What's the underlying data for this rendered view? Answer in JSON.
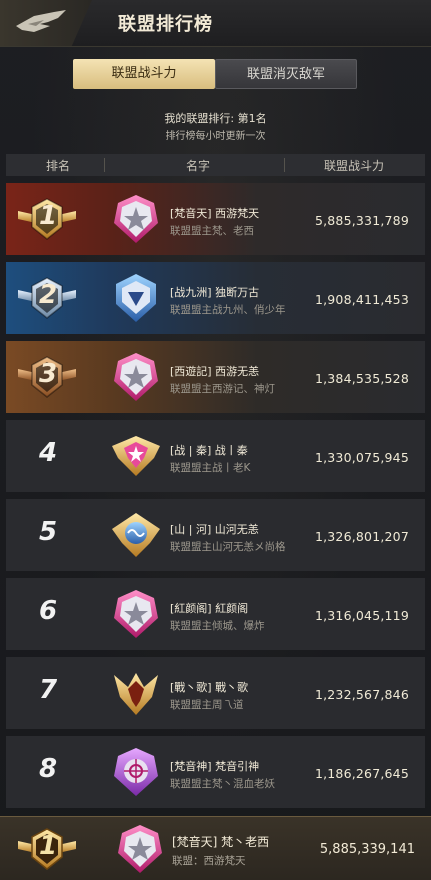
{
  "header": {
    "title": "联盟排行榜"
  },
  "tabs": [
    {
      "label": "联盟战斗力",
      "active": true
    },
    {
      "label": "联盟消灭敌军",
      "active": false
    }
  ],
  "my_rank_text": "我的联盟排行: 第1名",
  "refresh_note": "排行榜每小时更新一次",
  "columns": {
    "rank": "排名",
    "name": "名字",
    "power": "联盟战斗力"
  },
  "colors": {
    "accent_gold": "#d8bd7e",
    "rank1": "#7a2418",
    "rank2": "#1e4e7e",
    "rank3": "#7a4a24"
  },
  "rows": [
    {
      "rank": "1",
      "name": "[梵音天] 西游梵天",
      "leader": "联盟盟主梵、老西",
      "power": "5,885,331,789",
      "tier": "gold",
      "emblem": "pink-star-emblem"
    },
    {
      "rank": "2",
      "name": "[战九洲] 独断万古",
      "leader": "联盟盟主战九州、俏少年",
      "power": "1,908,411,453",
      "tier": "silver",
      "emblem": "blue-shield-emblem"
    },
    {
      "rank": "3",
      "name": "[西遊記] 西游无恙",
      "leader": "联盟盟主西游记、神灯",
      "power": "1,384,535,528",
      "tier": "bronze",
      "emblem": "pink-star-emblem"
    },
    {
      "rank": "4",
      "name": "[战 | 秦] 战丨秦",
      "leader": "联盟盟主战丨老K",
      "power": "1,330,075,945",
      "tier": "plain",
      "emblem": "gold-wing-emblem"
    },
    {
      "rank": "5",
      "name": "[山 | 河] 山河无恙",
      "leader": "联盟盟主山河无恙メ尚格",
      "power": "1,326,801,207",
      "tier": "plain",
      "emblem": "blue-wing-emblem"
    },
    {
      "rank": "6",
      "name": "[紅颜阁] 紅颜阁",
      "leader": "联盟盟主倾城、爆炸",
      "power": "1,316,045,119",
      "tier": "plain",
      "emblem": "pink-star-emblem"
    },
    {
      "rank": "7",
      "name": "[戰丶歌] 戰丶歌",
      "leader": "联盟盟主周乁道",
      "power": "1,232,567,846",
      "tier": "plain",
      "emblem": "gold-crest-emblem"
    },
    {
      "rank": "8",
      "name": "[梵音神] 梵音引神",
      "leader": "联盟盟主梵丶混血老妖",
      "power": "1,186,267,645",
      "tier": "plain",
      "emblem": "purple-target-emblem"
    }
  ],
  "own": {
    "rank": "1",
    "name": "[梵音天] 梵丶老西",
    "sub": "联盟：西游梵天",
    "power": "5,885,339,141"
  }
}
